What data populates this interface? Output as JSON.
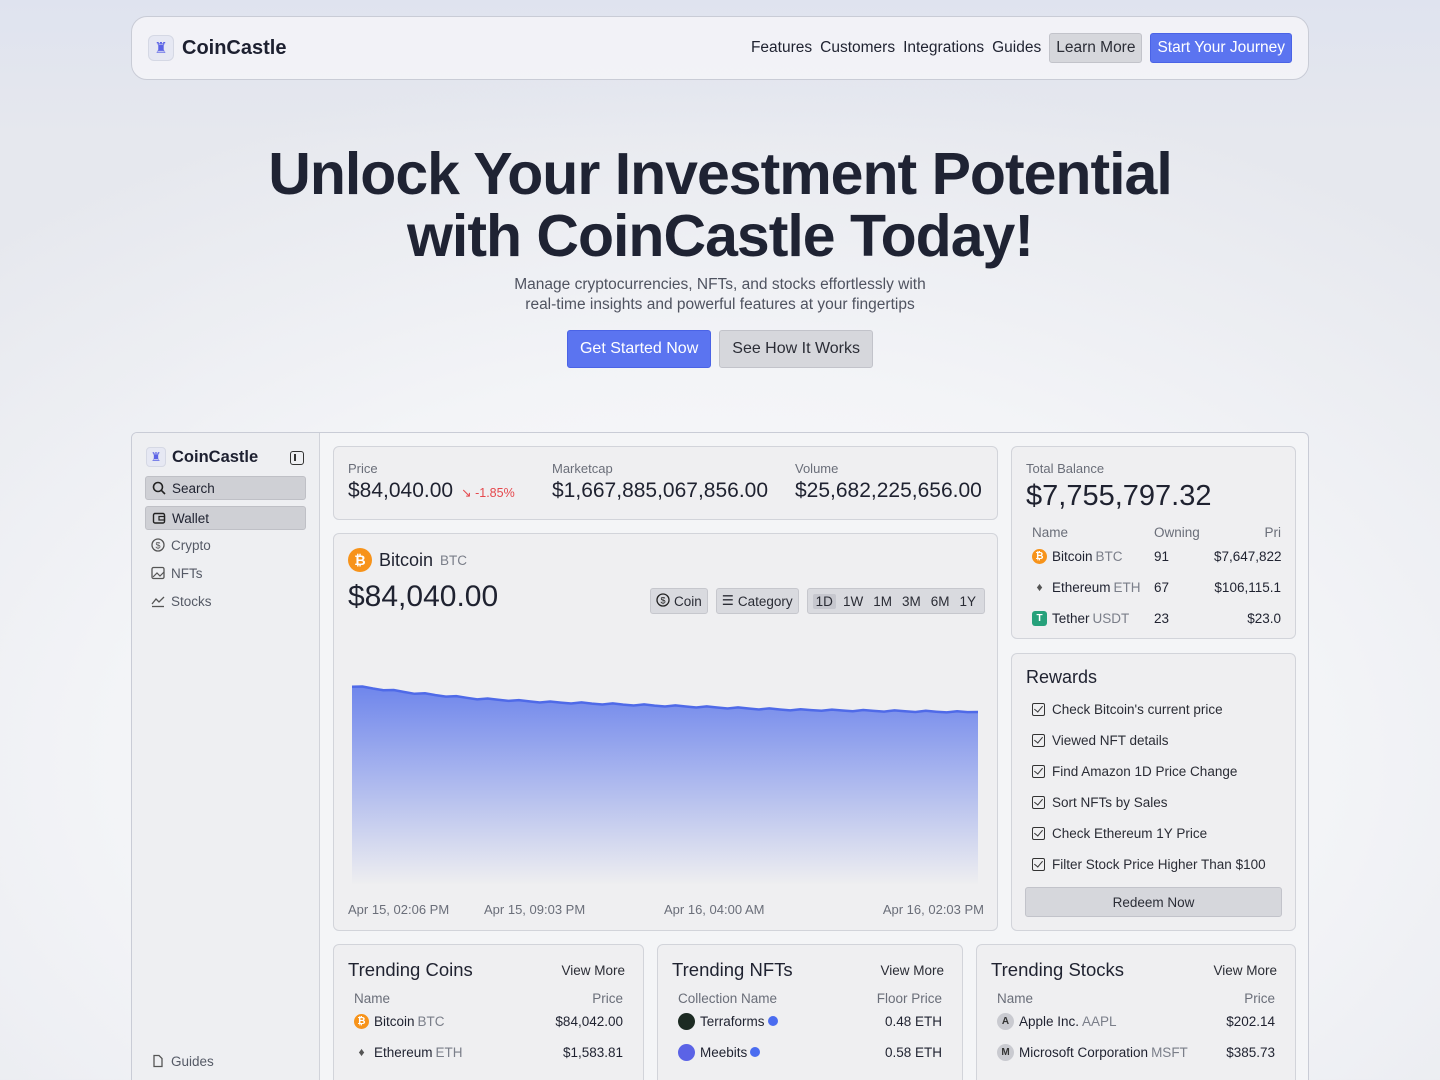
{
  "nav": {
    "brand": "CoinCastle",
    "links": [
      "Features",
      "Customers",
      "Integrations",
      "Guides"
    ],
    "learn_more": "Learn More",
    "start": "Start Your Journey"
  },
  "hero": {
    "title_line1": "Unlock Your Investment Potential",
    "title_line2": "with CoinCastle Today!",
    "sub_line1": "Manage cryptocurrencies, NFTs, and stocks effortlessly with",
    "sub_line2": "real-time insights and powerful features at your fingertips",
    "cta_primary": "Get Started Now",
    "cta_secondary": "See How It Works"
  },
  "sidebar": {
    "brand": "CoinCastle",
    "items": [
      {
        "label": "Search",
        "icon": "search-icon"
      },
      {
        "label": "Wallet",
        "icon": "wallet-icon"
      },
      {
        "label": "Crypto",
        "icon": "dollar-coin-icon"
      },
      {
        "label": "NFTs",
        "icon": "image-icon"
      },
      {
        "label": "Stocks",
        "icon": "chart-line-icon"
      }
    ],
    "guides": "Guides"
  },
  "stats": {
    "price_label": "Price",
    "price": "$84,040.00",
    "change": "-1.85%",
    "mcap_label": "Marketcap",
    "mcap": "$1,667,885,067,856.00",
    "vol_label": "Volume",
    "vol": "$25,682,225,656.00"
  },
  "chart": {
    "name": "Bitcoin",
    "symbol": "BTC",
    "price": "$84,040.00",
    "coin_btn": "Coin",
    "category_btn": "Category",
    "ranges": [
      "1D",
      "1W",
      "1M",
      "3M",
      "6M",
      "1Y"
    ],
    "selected_range": "1D",
    "x_labels": [
      "Apr 15, 02:06 PM",
      "Apr 15, 09:03 PM",
      "Apr 16, 04:00 AM",
      "Apr 16, 02:03 PM"
    ],
    "colors": {
      "line": "#4f6ae8",
      "fill_top": "#6f86ec",
      "fill_bottom": "#eeeef0"
    }
  },
  "chart_data": {
    "type": "area",
    "title": "Bitcoin",
    "x": [
      "Apr 15, 02:06 PM",
      "Apr 15, 09:03 PM",
      "Apr 16, 04:00 AM",
      "Apr 16, 02:03 PM"
    ],
    "values": [
      84700,
      84520,
      84380,
      84300,
      84250,
      84200,
      84150,
      84100,
      84080,
      84060,
      84040
    ],
    "series": [
      {
        "name": "BTC",
        "values": [
          84700,
          84520,
          84380,
          84300,
          84250,
          84200,
          84150,
          84100,
          84080,
          84060,
          84040
        ]
      }
    ]
  },
  "balance": {
    "label": "Total Balance",
    "value": "$7,755,797.32",
    "headers": [
      "Name",
      "Owning",
      "Pri"
    ],
    "rows": [
      {
        "name": "Bitcoin",
        "sym": "BTC",
        "own": "91",
        "price": "$7,647,822.0"
      },
      {
        "name": "Ethereum",
        "sym": "ETH",
        "own": "67",
        "price": "$106,115.1"
      },
      {
        "name": "Tether",
        "sym": "USDT",
        "own": "23",
        "price": "$23.0"
      }
    ]
  },
  "rewards": {
    "title": "Rewards",
    "items": [
      "Check Bitcoin's current price",
      "Viewed NFT details",
      "Find Amazon 1D Price Change",
      "Sort NFTs by Sales",
      "Check Ethereum 1Y Price",
      "Filter Stock Price Higher Than $100"
    ],
    "redeem": "Redeem Now"
  },
  "trending_coins": {
    "title": "Trending Coins",
    "view_more": "View More",
    "headers": [
      "Name",
      "Price"
    ],
    "rows": [
      {
        "name": "Bitcoin",
        "sym": "BTC",
        "price": "$84,042.00"
      },
      {
        "name": "Ethereum",
        "sym": "ETH",
        "price": "$1,583.81"
      }
    ]
  },
  "trending_nfts": {
    "title": "Trending NFTs",
    "view_more": "View More",
    "headers": [
      "Collection Name",
      "Floor Price"
    ],
    "rows": [
      {
        "name": "Terraforms",
        "price": "0.48 ETH"
      },
      {
        "name": "Meebits",
        "price": "0.58 ETH"
      }
    ]
  },
  "trending_stocks": {
    "title": "Trending Stocks",
    "view_more": "View More",
    "headers": [
      "Name",
      "Price"
    ],
    "rows": [
      {
        "name": "Apple Inc.",
        "sym": "AAPL",
        "price": "$202.14"
      },
      {
        "name": "Microsoft Corporation",
        "sym": "MSFT",
        "price": "$385.73"
      }
    ]
  }
}
